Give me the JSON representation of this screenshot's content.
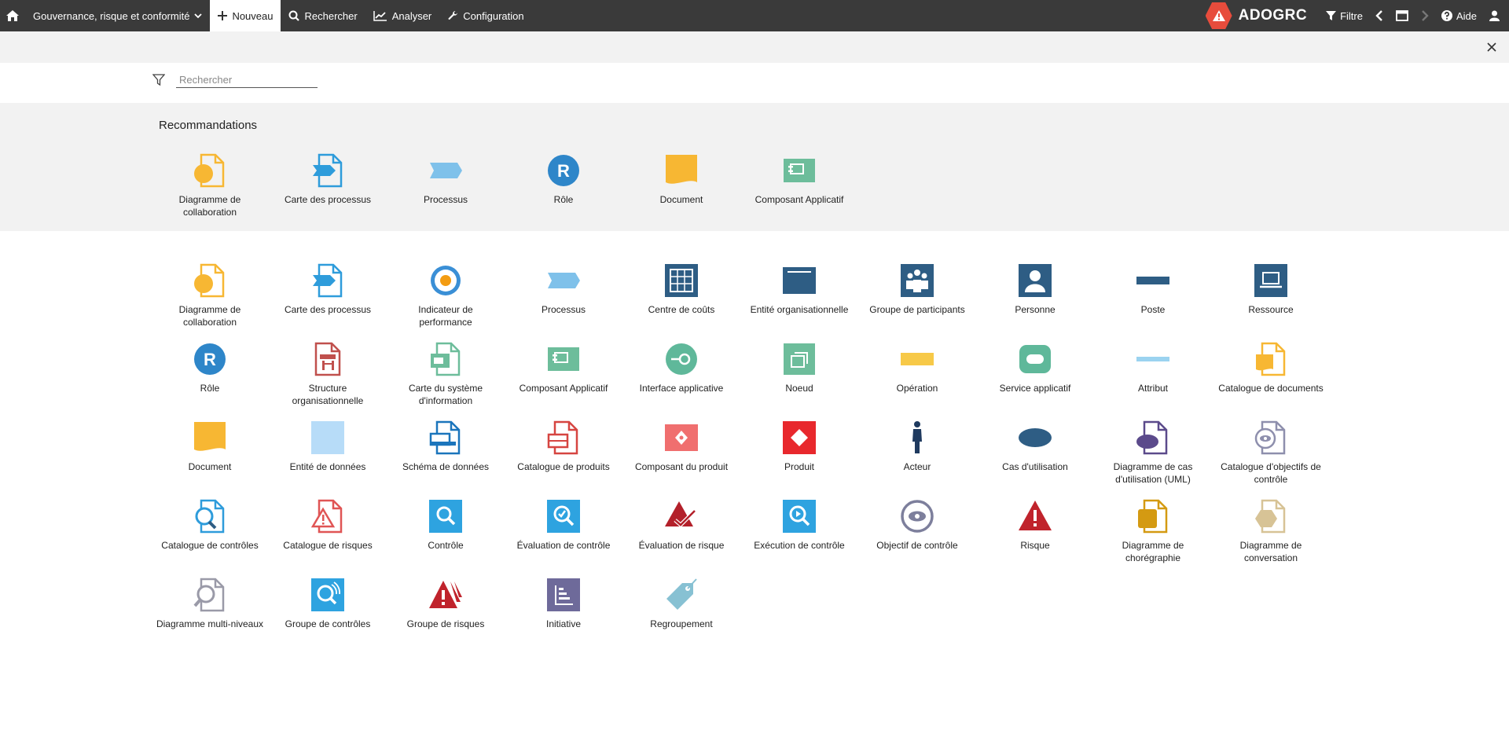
{
  "topbar": {
    "home_icon": "home-icon",
    "module": "Gouvernance, risque et conformité",
    "new": "Nouveau",
    "search": "Rechercher",
    "analyze": "Analyser",
    "config": "Configuration",
    "brand": "ADOGRC",
    "filter": "Filtre",
    "help": "Aide"
  },
  "search": {
    "placeholder": "Rechercher"
  },
  "recommendations": {
    "title": "Recommandations",
    "items": [
      {
        "label": "Diagramme de collaboration",
        "icon": "collab"
      },
      {
        "label": "Carte des processus",
        "icon": "procmap"
      },
      {
        "label": "Processus",
        "icon": "process"
      },
      {
        "label": "Rôle",
        "icon": "role"
      },
      {
        "label": "Document",
        "icon": "document"
      },
      {
        "label": "Composant Applicatif",
        "icon": "appcomp"
      }
    ]
  },
  "objects": [
    {
      "label": "Diagramme de collaboration",
      "icon": "collab"
    },
    {
      "label": "Carte des processus",
      "icon": "procmap"
    },
    {
      "label": "Indicateur de performance",
      "icon": "kpi"
    },
    {
      "label": "Processus",
      "icon": "process"
    },
    {
      "label": "Centre de coûts",
      "icon": "costcenter"
    },
    {
      "label": "Entité organisationnelle",
      "icon": "orgunit"
    },
    {
      "label": "Groupe de participants",
      "icon": "pgroup"
    },
    {
      "label": "Personne",
      "icon": "person"
    },
    {
      "label": "Poste",
      "icon": "position"
    },
    {
      "label": "Ressource",
      "icon": "resource"
    },
    {
      "label": "Rôle",
      "icon": "role"
    },
    {
      "label": "Structure organisationnelle",
      "icon": "orgstruct"
    },
    {
      "label": "Carte du système d'information",
      "icon": "ismap"
    },
    {
      "label": "Composant Applicatif",
      "icon": "appcomp"
    },
    {
      "label": "Interface applicative",
      "icon": "appiface"
    },
    {
      "label": "Noeud",
      "icon": "node"
    },
    {
      "label": "Opération",
      "icon": "operation"
    },
    {
      "label": "Service applicatif",
      "icon": "appservice"
    },
    {
      "label": "Attribut",
      "icon": "attribute"
    },
    {
      "label": "Catalogue de documents",
      "icon": "doccat"
    },
    {
      "label": "Document",
      "icon": "document"
    },
    {
      "label": "Entité de données",
      "icon": "dataentity"
    },
    {
      "label": "Schéma de données",
      "icon": "dataschema"
    },
    {
      "label": "Catalogue de produits",
      "icon": "prodcat"
    },
    {
      "label": "Composant du produit",
      "icon": "prodcomp"
    },
    {
      "label": "Produit",
      "icon": "product"
    },
    {
      "label": "Acteur",
      "icon": "actor"
    },
    {
      "label": "Cas d'utilisation",
      "icon": "usecase"
    },
    {
      "label": "Diagramme de cas d'utilisation (UML)",
      "icon": "ucdiagram"
    },
    {
      "label": "Catalogue d'objectifs de contrôle",
      "icon": "ctrlobjcat"
    },
    {
      "label": "Catalogue de contrôles",
      "icon": "ctrlcat"
    },
    {
      "label": "Catalogue de risques",
      "icon": "riskcat"
    },
    {
      "label": "Contrôle",
      "icon": "control"
    },
    {
      "label": "Évaluation de contrôle",
      "icon": "ctrleval"
    },
    {
      "label": "Évaluation de risque",
      "icon": "riskeval"
    },
    {
      "label": "Exécution de contrôle",
      "icon": "ctrlexec"
    },
    {
      "label": "Objectif de contrôle",
      "icon": "ctrlobj"
    },
    {
      "label": "Risque",
      "icon": "risk"
    },
    {
      "label": "Diagramme de chorégraphie",
      "icon": "choreo"
    },
    {
      "label": "Diagramme de conversation",
      "icon": "conversation"
    },
    {
      "label": "Diagramme multi-niveaux",
      "icon": "multilevel"
    },
    {
      "label": "Groupe de contrôles",
      "icon": "ctrlgroup"
    },
    {
      "label": "Groupe de risques",
      "icon": "riskgroup"
    },
    {
      "label": "Initiative",
      "icon": "initiative"
    },
    {
      "label": "Regroupement",
      "icon": "grouping"
    }
  ]
}
